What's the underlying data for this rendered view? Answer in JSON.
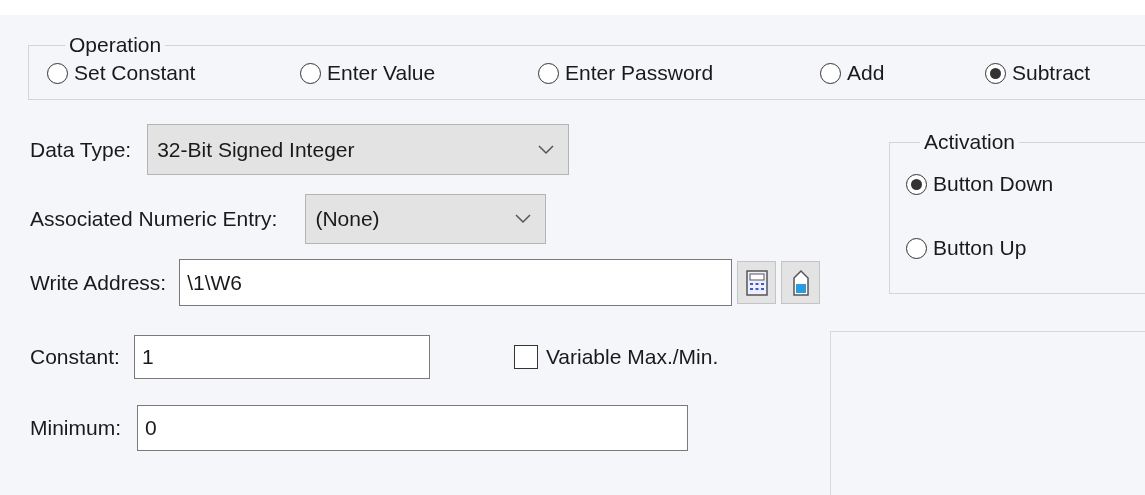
{
  "operation": {
    "title": "Operation",
    "options": [
      {
        "label": "Set Constant",
        "selected": false
      },
      {
        "label": "Enter Value",
        "selected": false
      },
      {
        "label": "Enter Password",
        "selected": false
      },
      {
        "label": "Add",
        "selected": false
      },
      {
        "label": "Subtract",
        "selected": true
      }
    ]
  },
  "data_type": {
    "label": "Data Type:",
    "value": "32-Bit Signed Integer"
  },
  "associated_numeric_entry": {
    "label": "Associated Numeric Entry:",
    "value": "(None)"
  },
  "write_address": {
    "label": "Write Address:",
    "value": "\\1\\W6"
  },
  "constant": {
    "label": "Constant:",
    "value": "1"
  },
  "variable_max_min": {
    "label": "Variable Max./Min.",
    "checked": false
  },
  "minimum": {
    "label": "Minimum:",
    "value": "0"
  },
  "activation": {
    "title": "Activation",
    "options": [
      {
        "label": "Button Down",
        "selected": true
      },
      {
        "label": "Button Up",
        "selected": false
      }
    ]
  }
}
